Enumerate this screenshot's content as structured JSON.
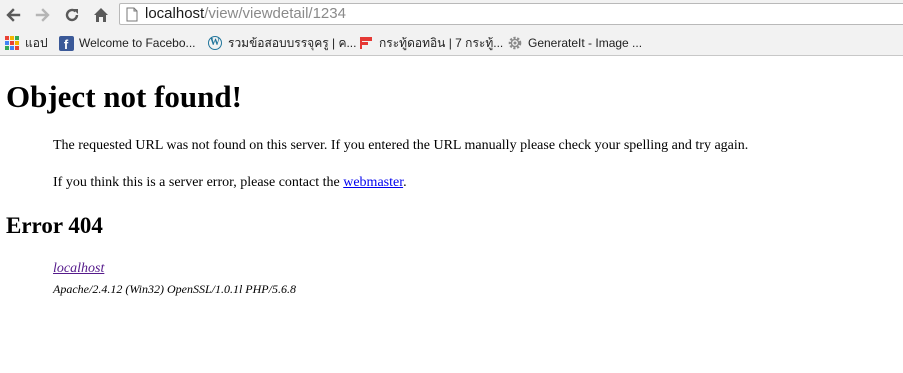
{
  "toolbar": {
    "url_host": "localhost",
    "url_path": "/view/viewdetail/1234"
  },
  "bookmarks": [
    {
      "label": "แอป",
      "icon": "apps-icon"
    },
    {
      "label": "Welcome to Facebo...",
      "icon": "facebook-icon"
    },
    {
      "label": "รวมข้อสอบบรรจุครู | ค...",
      "icon": "wordpress-icon"
    },
    {
      "label": "กระทู้ดอทอิน | 7 กระทู้...",
      "icon": "red-flag-icon"
    },
    {
      "label": "GenerateIt - Image ...",
      "icon": "gear-icon"
    }
  ],
  "page": {
    "title": "Object not found!",
    "para1": "The requested URL was not found on this server. If you entered the URL manually please check your spelling and try again.",
    "para2_before": "If you think this is a server error, please contact the ",
    "para2_link": "webmaster",
    "para2_after": ".",
    "error_heading": "Error 404",
    "address_link": "localhost",
    "server_info": "Apache/2.4.12 (Win32) OpenSSL/1.0.1l PHP/5.6.8"
  },
  "colors": {
    "link_unvisited": "#0000ee",
    "link_visited": "#551a8b",
    "chrome_bg": "#f2f2f2"
  }
}
